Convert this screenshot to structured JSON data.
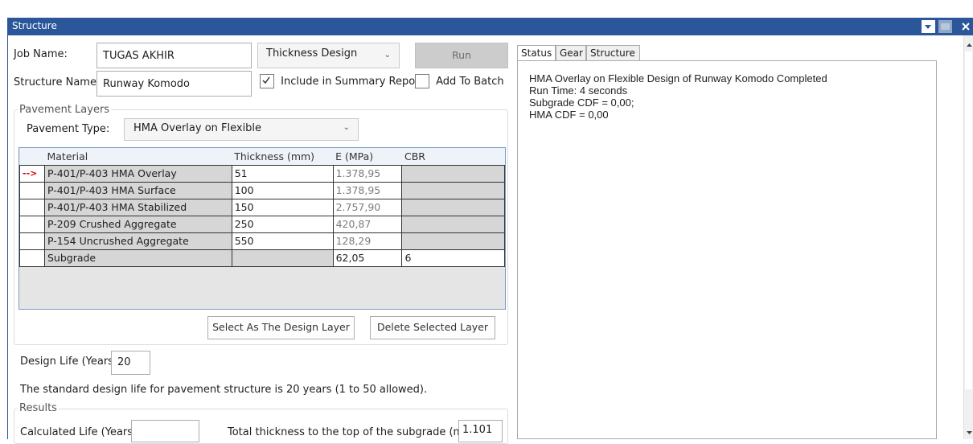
{
  "window": {
    "title": "Structure"
  },
  "job": {
    "label": "Job Name:",
    "value": "TUGAS AKHIR"
  },
  "structure": {
    "label": "Structure Name:",
    "value": "Runway Komodo"
  },
  "design_type": {
    "selected": "Thickness Design"
  },
  "run_button": "Run",
  "summary_checkbox": {
    "label": "Include in Summary Report",
    "checked": true
  },
  "batch_checkbox": {
    "label": "Add To Batch",
    "checked": false
  },
  "pavement_layers": {
    "legend": "Pavement Layers",
    "type_label": "Pavement Type:",
    "type_value": "HMA Overlay on Flexible",
    "columns": [
      "Material",
      "Thickness (mm)",
      "E (MPa)",
      "CBR"
    ],
    "rows": [
      {
        "indicator": "-->",
        "material": "P-401/P-403 HMA Overlay",
        "thickness": "51",
        "e": "1.378,95",
        "cbr": ""
      },
      {
        "indicator": "",
        "material": "P-401/P-403 HMA Surface",
        "thickness": "100",
        "e": "1.378,95",
        "cbr": ""
      },
      {
        "indicator": "",
        "material": "P-401/P-403 HMA Stabilized",
        "thickness": "150",
        "e": "2.757,90",
        "cbr": ""
      },
      {
        "indicator": "",
        "material": "P-209 Crushed Aggregate",
        "thickness": "250",
        "e": "420,87",
        "cbr": ""
      },
      {
        "indicator": "",
        "material": "P-154 Uncrushed Aggregate",
        "thickness": "550",
        "e": "128,29",
        "cbr": ""
      },
      {
        "indicator": "",
        "material": "Subgrade",
        "thickness": "",
        "e": "62,05",
        "cbr": "6"
      }
    ],
    "select_design_layer": "Select As The Design Layer",
    "delete_layer": "Delete Selected Layer"
  },
  "design_life": {
    "label": "Design Life (Years):",
    "value": "20",
    "note": "The standard design life for pavement structure is 20 years (1 to 50 allowed)."
  },
  "results": {
    "legend": "Results",
    "calc_life_label": "Calculated Life (Years):",
    "calc_life_value": "",
    "total_thickness_label": "Total thickness to the top of the subgrade (mm):",
    "total_thickness_value": "1.101"
  },
  "tabs": [
    "Status",
    "Gear",
    "Structure"
  ],
  "status_lines": [
    "HMA Overlay on Flexible Design of Runway Komodo Completed",
    "Run Time: 4 seconds",
    "Subgrade CDF = 0,00;",
    "HMA CDF  = 0,00"
  ],
  "colors": {
    "titlebar": "#2b579a",
    "indicator_arrow": "#d00000",
    "grid_header": "#eef3fa"
  },
  "icons": [
    "dropdown-arrow-icon",
    "pin-icon",
    "close-icon",
    "checkmark-icon",
    "scroll-up-icon",
    "scroll-down-icon"
  ]
}
